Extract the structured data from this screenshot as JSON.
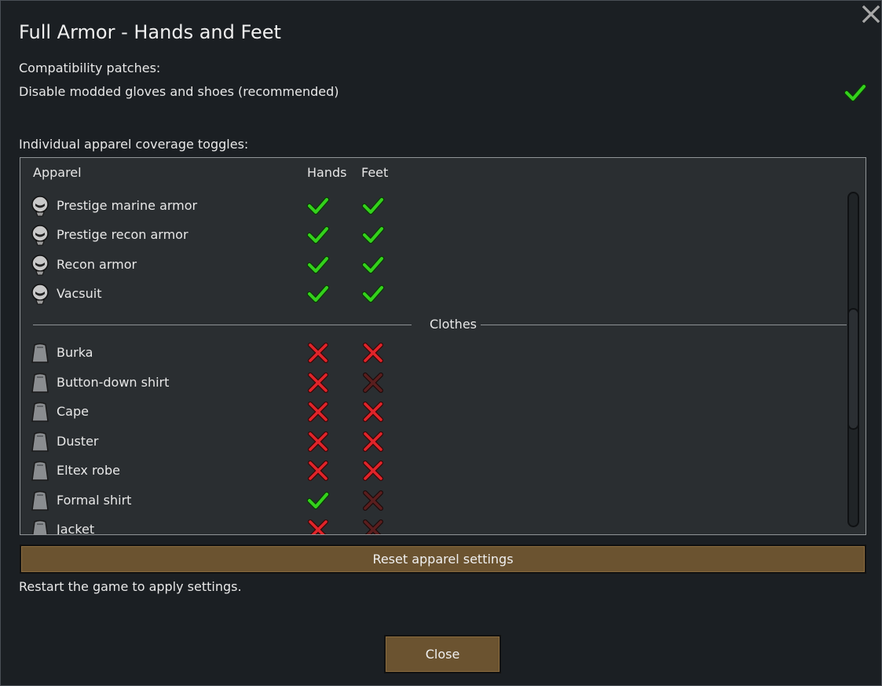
{
  "dialog": {
    "title": "Full Armor - Hands and Feet",
    "compat_heading": "Compatibility patches:",
    "compat_option": "Disable modded gloves and shoes (recommended)",
    "compat_enabled": true,
    "toggles_heading": "Individual apparel coverage toggles:",
    "close_icon": "close-x-icon"
  },
  "table": {
    "col_apparel": "Apparel",
    "col_hands": "Hands",
    "col_feet": "Feet",
    "group_armor": [
      {
        "name": "Prestige marine armor",
        "hands": true,
        "feet": true
      },
      {
        "name": "Prestige recon armor",
        "hands": true,
        "feet": true
      },
      {
        "name": "Recon armor",
        "hands": true,
        "feet": true
      },
      {
        "name": "Vacsuit",
        "hands": true,
        "feet": true
      }
    ],
    "separator_label": "Clothes",
    "group_clothes": [
      {
        "name": "Burka",
        "hands": false,
        "feet": false
      },
      {
        "name": "Button-down shirt",
        "hands": false,
        "feet": false,
        "feet_dim": true
      },
      {
        "name": "Cape",
        "hands": false,
        "feet": false
      },
      {
        "name": "Duster",
        "hands": false,
        "feet": false
      },
      {
        "name": "Eltex robe",
        "hands": false,
        "feet": false
      },
      {
        "name": "Formal shirt",
        "hands": true,
        "feet": false,
        "feet_dim": true
      },
      {
        "name": "Jacket",
        "hands": false,
        "feet": false,
        "feet_dim": true
      }
    ]
  },
  "buttons": {
    "reset_label": "Reset apparel settings",
    "close_label": "Close"
  },
  "restart_note": "Restart the game to apply settings.",
  "colors": {
    "check": "#34d11c",
    "cross": "#e0242a",
    "cross_dim": "#5a1e1e",
    "button": "#6b5330"
  }
}
